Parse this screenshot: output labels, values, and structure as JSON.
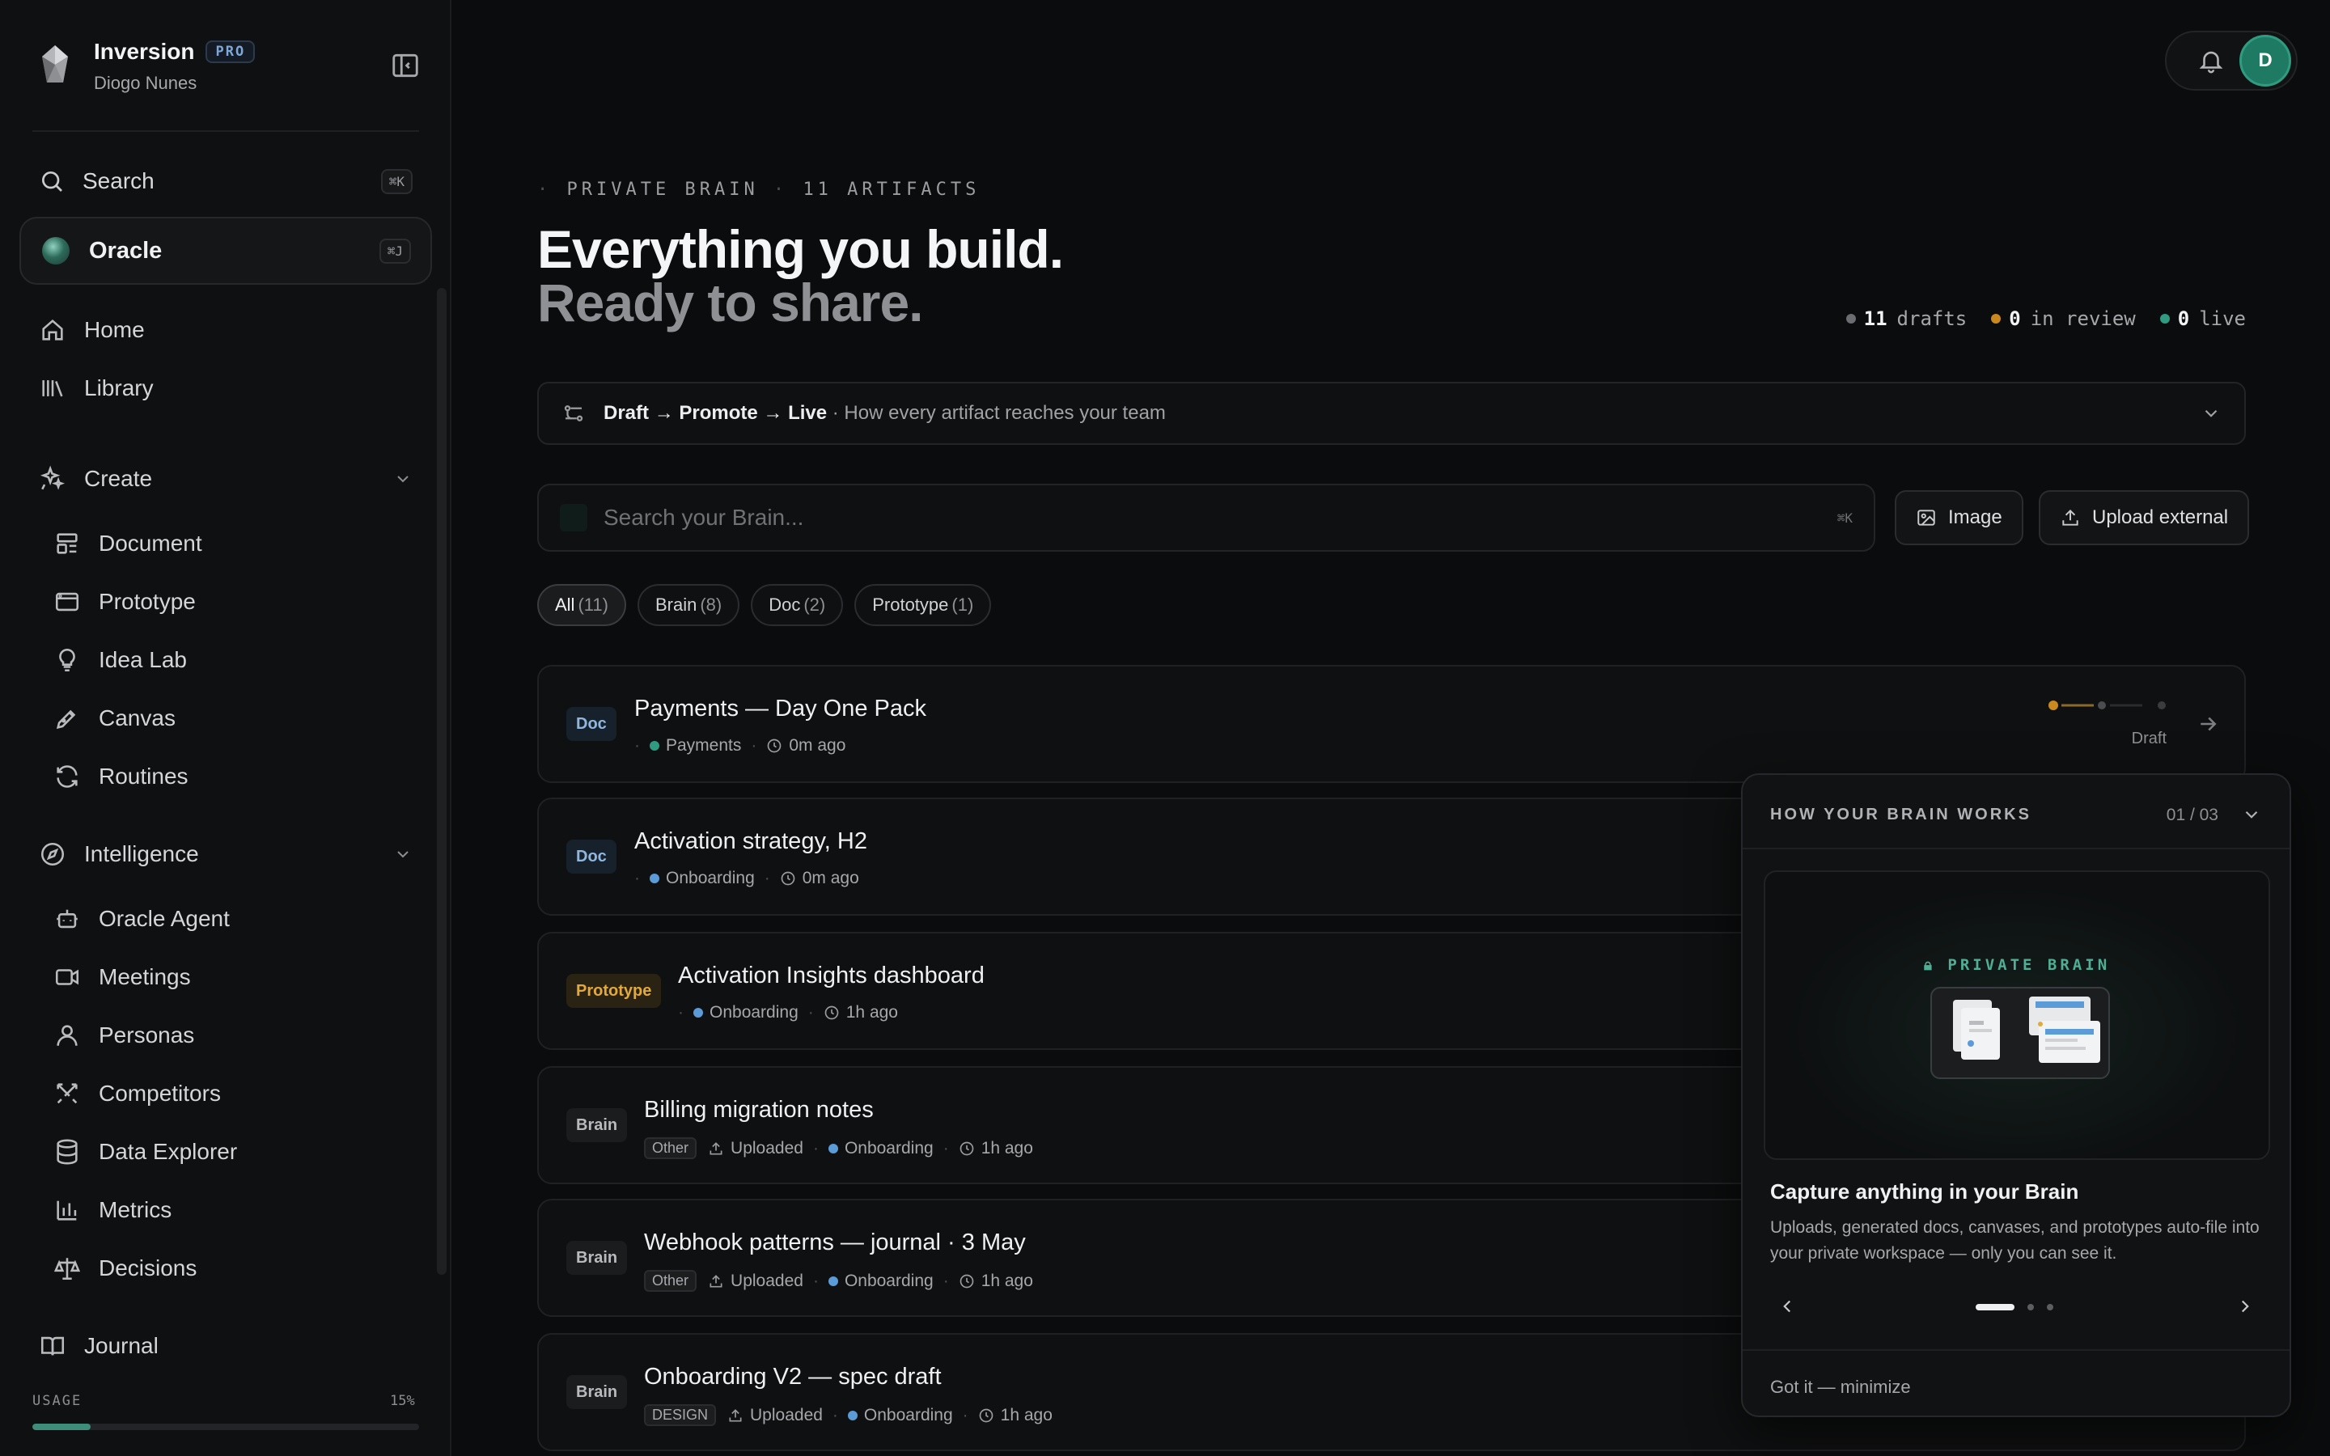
{
  "brand": {
    "name": "Inversion",
    "badge": "PRO",
    "user": "Diogo Nunes"
  },
  "sidebar": {
    "search": {
      "label": "Search",
      "shortcut": "⌘K"
    },
    "oracle": {
      "label": "Oracle",
      "shortcut": "⌘J"
    },
    "top_items": [
      {
        "label": "Home",
        "icon": "home-icon"
      },
      {
        "label": "Library",
        "icon": "library-icon"
      }
    ],
    "create": {
      "label": "Create",
      "items": [
        {
          "label": "Document",
          "icon": "document-icon"
        },
        {
          "label": "Prototype",
          "icon": "prototype-icon"
        },
        {
          "label": "Idea Lab",
          "icon": "lightbulb-icon"
        },
        {
          "label": "Canvas",
          "icon": "pen-icon"
        },
        {
          "label": "Routines",
          "icon": "refresh-icon"
        }
      ]
    },
    "intelligence": {
      "label": "Intelligence",
      "items": [
        {
          "label": "Oracle Agent",
          "icon": "bot-icon"
        },
        {
          "label": "Meetings",
          "icon": "video-icon"
        },
        {
          "label": "Personas",
          "icon": "person-icon"
        },
        {
          "label": "Competitors",
          "icon": "swords-icon"
        },
        {
          "label": "Data Explorer",
          "icon": "database-icon"
        },
        {
          "label": "Metrics",
          "icon": "bar-chart-icon"
        },
        {
          "label": "Decisions",
          "icon": "scale-icon"
        }
      ]
    },
    "journal": {
      "label": "Journal",
      "icon": "book-icon"
    },
    "usage": {
      "label": "USAGE",
      "percent_label": "15%",
      "fraction": 0.15
    }
  },
  "topbar": {
    "avatar_initial": "D"
  },
  "header": {
    "eyebrow_a": "PRIVATE BRAIN",
    "eyebrow_b": "11 ARTIFACTS",
    "title_line1": "Everything you build.",
    "title_line2": "Ready to share.",
    "stats": [
      {
        "value": "11",
        "label": "drafts",
        "color": "#6b6d70"
      },
      {
        "value": "0",
        "label": "in review",
        "color": "#c9891e"
      },
      {
        "value": "0",
        "label": "live",
        "color": "#2f9b80"
      }
    ]
  },
  "flow": {
    "step1": "Draft",
    "arrow": "→",
    "step2": "Promote",
    "step3": "Live",
    "caption": "· How every artifact reaches your team"
  },
  "brain_search": {
    "placeholder": "Search your Brain...",
    "shortcut": "⌘K"
  },
  "actions": {
    "image_label": "Image",
    "upload_label": "Upload external"
  },
  "filters": [
    {
      "label": "All",
      "count": "(11)",
      "active": true
    },
    {
      "label": "Brain",
      "count": "(8)",
      "active": false
    },
    {
      "label": "Doc",
      "count": "(2)",
      "active": false
    },
    {
      "label": "Prototype",
      "count": "(1)",
      "active": false
    }
  ],
  "artifacts": [
    {
      "tag": "Doc",
      "title": "Payments — Day One Pack",
      "topic": "Payments",
      "topic_color": "#2f9b80",
      "time": "0m ago",
      "status": "Draft"
    },
    {
      "tag": "Doc",
      "title": "Activation strategy, H2",
      "topic": "Onboarding",
      "topic_color": "#5b9bd8",
      "time": "0m ago"
    },
    {
      "tag": "Prototype",
      "title": "Activation Insights dashboard",
      "topic": "Onboarding",
      "topic_color": "#5b9bd8",
      "time": "1h ago"
    },
    {
      "tag": "Brain",
      "title": "Billing migration notes",
      "kind": "Other",
      "source": "Uploaded",
      "topic": "Onboarding",
      "topic_color": "#5b9bd8",
      "time": "1h ago"
    },
    {
      "tag": "Brain",
      "title": "Webhook patterns — journal · 3 May",
      "kind": "Other",
      "source": "Uploaded",
      "topic": "Onboarding",
      "topic_color": "#5b9bd8",
      "time": "1h ago"
    },
    {
      "tag": "Brain",
      "title": "Onboarding V2 — spec draft",
      "kind": "DESIGN",
      "source": "Uploaded",
      "topic": "Onboarding",
      "topic_color": "#5b9bd8",
      "time": "1h ago"
    }
  ],
  "panel": {
    "heading": "HOW YOUR BRAIN WORKS",
    "step": "01 / 03",
    "illus_label": "PRIVATE BRAIN",
    "title": "Capture anything in your Brain",
    "description": "Uploads, generated docs, canvases, and prototypes auto-file into your private workspace — only you can see it.",
    "footer": "Got it — minimize"
  }
}
